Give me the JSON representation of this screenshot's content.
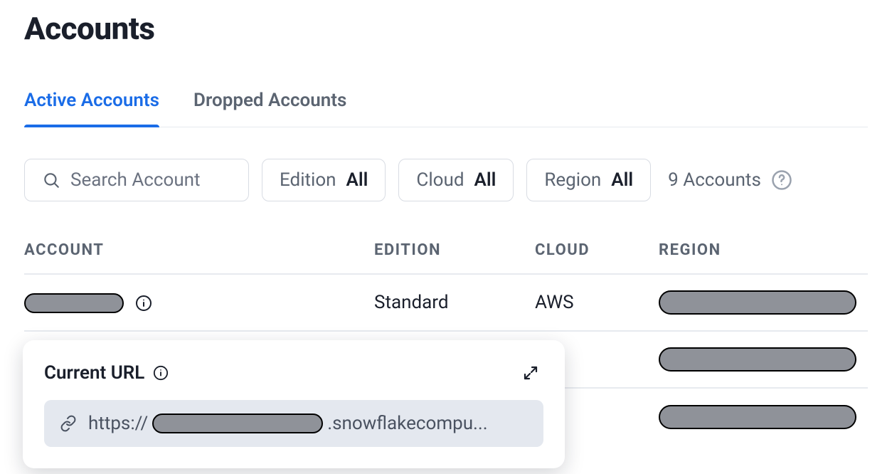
{
  "title": "Accounts",
  "tabs": {
    "active": "Active Accounts",
    "dropped": "Dropped Accounts"
  },
  "filters": {
    "search_placeholder": "Search Account",
    "edition_label": "Edition",
    "edition_value": "All",
    "cloud_label": "Cloud",
    "cloud_value": "All",
    "region_label": "Region",
    "region_value": "All"
  },
  "summary": {
    "count_text": "9 Accounts"
  },
  "table": {
    "headers": {
      "account": "ACCOUNT",
      "edition": "EDITION",
      "cloud": "CLOUD",
      "region": "REGION"
    },
    "rows": [
      {
        "edition": "Standard",
        "cloud": "AWS"
      },
      {
        "edition": "",
        "cloud": ""
      },
      {
        "edition": "",
        "cloud": ""
      }
    ]
  },
  "popover": {
    "title": "Current URL",
    "url_prefix": "https://",
    "url_suffix": ".snowflakecompu..."
  }
}
